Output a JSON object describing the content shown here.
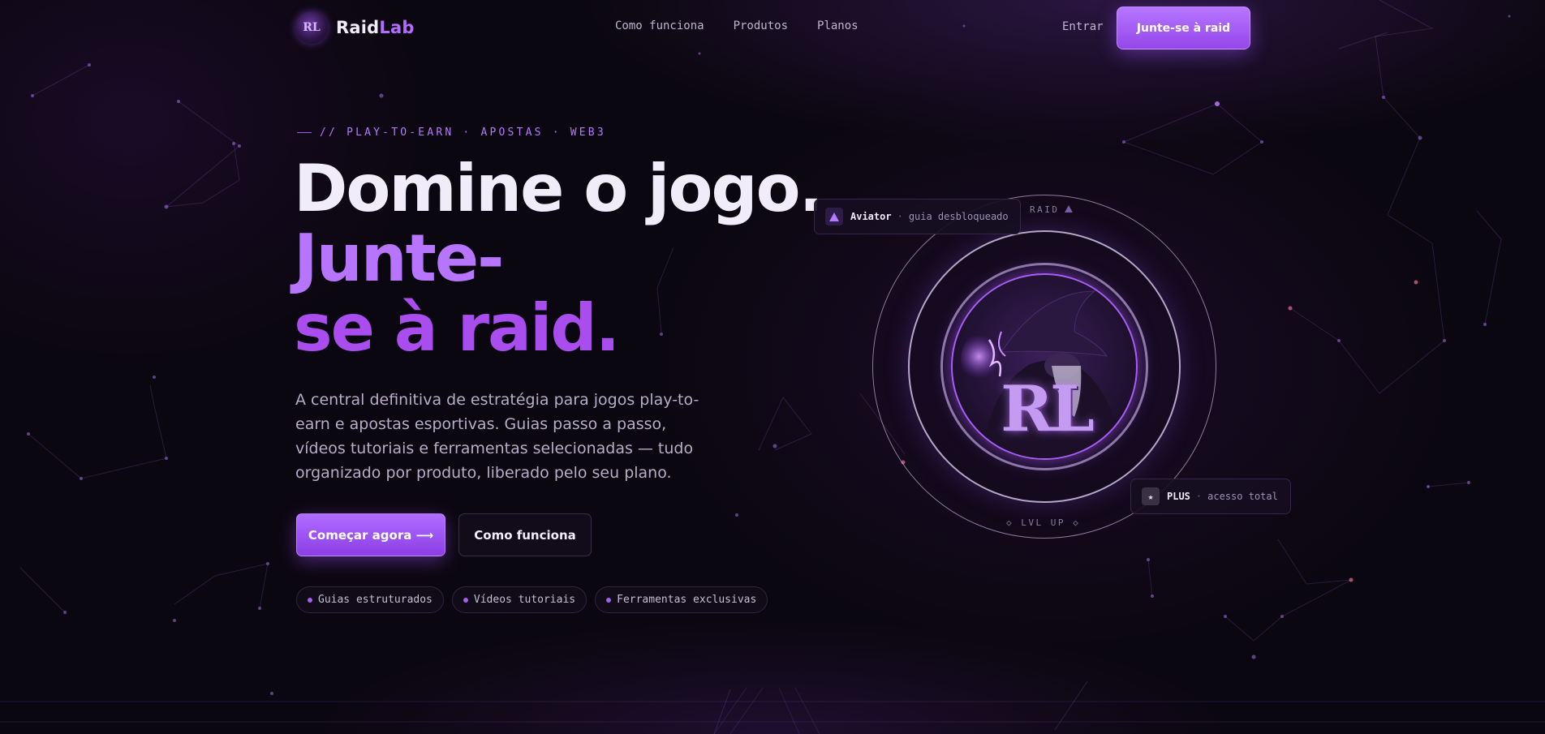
{
  "nav": {
    "brand_main": "Raid",
    "brand_accent": "Lab",
    "logo_mark": "RL",
    "links": [
      "Como funciona",
      "Produtos",
      "Planos"
    ],
    "login": "Entrar",
    "join": "Junte-se à raid"
  },
  "hero": {
    "eyebrow": "// PLAY-TO-EARN · APOSTAS · WEB3",
    "title_line1": "Domine o jogo.",
    "title_line2": "Junte-",
    "title_line3": "se à raid.",
    "description": "A central definitiva de estratégia para jogos play-to-earn e apostas esportivas. Guias passo a passo, vídeos tutoriais e ferramentas selecionadas — tudo organizado por produto, liberado pelo seu plano.",
    "cta_primary": "Começar agora ⟶",
    "cta_secondary": "Como funciona",
    "chips": [
      "Guias estruturados",
      "Vídeos tutoriais",
      "Ferramentas exclusivas"
    ]
  },
  "emblem": {
    "top_label": "RAID",
    "bottom_label": "◇ LVL UP ◇",
    "center_mark": "RL",
    "aviator_badge": {
      "name": "Aviator",
      "text": "guia desbloqueado",
      "icon": "triangle-icon"
    },
    "plus_badge": {
      "name": "PLUS",
      "text": "acesso total",
      "icon": "star-icon",
      "icon_glyph": "★"
    }
  },
  "colors": {
    "background": "#0b0710",
    "accent": "#b26cff",
    "accent_dark": "#8b3fe6",
    "text": "#f1ecfa",
    "muted": "#b8acc8"
  }
}
